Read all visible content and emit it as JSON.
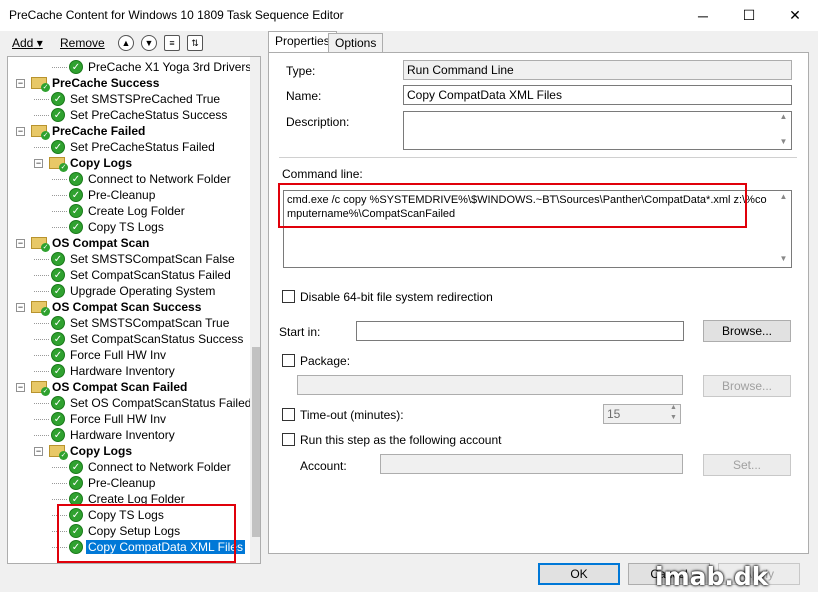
{
  "window": {
    "title": "PreCache Content for Windows 10 1809 Task Sequence Editor",
    "minimize": "─",
    "maximize": "☐",
    "close": "✕"
  },
  "toolbar": {
    "add_label": "Add",
    "remove_label": "Remove"
  },
  "tree": {
    "items": [
      {
        "label": "PreCache X1 Yoga 3rd Drivers",
        "level": 3,
        "kind": "step"
      },
      {
        "label": "PreCache Success",
        "level": 1,
        "kind": "group"
      },
      {
        "label": "Set SMSTSPreCached True",
        "level": 2,
        "kind": "step"
      },
      {
        "label": "Set PreCacheStatus Success",
        "level": 2,
        "kind": "step"
      },
      {
        "label": "PreCache Failed",
        "level": 1,
        "kind": "group"
      },
      {
        "label": "Set PreCacheStatus Failed",
        "level": 2,
        "kind": "step"
      },
      {
        "label": "Copy Logs",
        "level": 2,
        "kind": "group"
      },
      {
        "label": "Connect to Network Folder",
        "level": 3,
        "kind": "step"
      },
      {
        "label": "Pre-Cleanup",
        "level": 3,
        "kind": "step"
      },
      {
        "label": "Create Log Folder",
        "level": 3,
        "kind": "step"
      },
      {
        "label": "Copy TS Logs",
        "level": 3,
        "kind": "step"
      },
      {
        "label": "OS Compat Scan",
        "level": 1,
        "kind": "group"
      },
      {
        "label": "Set SMSTSCompatScan False",
        "level": 2,
        "kind": "step"
      },
      {
        "label": "Set CompatScanStatus Failed",
        "level": 2,
        "kind": "step"
      },
      {
        "label": "Upgrade Operating System",
        "level": 2,
        "kind": "step"
      },
      {
        "label": "OS Compat Scan Success",
        "level": 1,
        "kind": "group"
      },
      {
        "label": "Set SMSTSCompatScan True",
        "level": 2,
        "kind": "step"
      },
      {
        "label": "Set CompatScanStatus Success",
        "level": 2,
        "kind": "step"
      },
      {
        "label": "Force Full HW Inv",
        "level": 2,
        "kind": "step"
      },
      {
        "label": "Hardware Inventory",
        "level": 2,
        "kind": "step"
      },
      {
        "label": "OS Compat Scan Failed",
        "level": 1,
        "kind": "group"
      },
      {
        "label": "Set OS CompatScanStatus Failed",
        "level": 2,
        "kind": "step"
      },
      {
        "label": "Force Full HW Inv",
        "level": 2,
        "kind": "step"
      },
      {
        "label": "Hardware Inventory",
        "level": 2,
        "kind": "step"
      },
      {
        "label": "Copy Logs",
        "level": 2,
        "kind": "group"
      },
      {
        "label": "Connect to Network Folder",
        "level": 3,
        "kind": "step"
      },
      {
        "label": "Pre-Cleanup",
        "level": 3,
        "kind": "step"
      },
      {
        "label": "Create Log Folder",
        "level": 3,
        "kind": "step"
      },
      {
        "label": "Copy TS Logs",
        "level": 3,
        "kind": "step"
      },
      {
        "label": "Copy Setup Logs",
        "level": 3,
        "kind": "step"
      },
      {
        "label": "Copy CompatData XML Files",
        "level": 3,
        "kind": "step",
        "selected": true
      }
    ]
  },
  "tabs": [
    {
      "label": "Properties",
      "active": true
    },
    {
      "label": "Options",
      "active": false
    }
  ],
  "properties": {
    "type_label": "Type:",
    "type_value": "Run Command Line",
    "name_label": "Name:",
    "name_value": "Copy CompatData XML Files",
    "description_label": "Description:",
    "description_value": "",
    "command_line_label": "Command line:",
    "command_line_value": "cmd.exe /c copy %SYSTEMDRIVE%\\$WINDOWS.~BT\\Sources\\Panther\\CompatData*.xml z:\\%computername%\\CompatScanFailed",
    "disable_64bit_label": "Disable 64-bit file system redirection",
    "start_in_label": "Start in:",
    "start_in_value": "",
    "browse_label": "Browse...",
    "package_label": "Package:",
    "package_value": "",
    "browse2_label": "Browse...",
    "timeout_label": "Time-out (minutes):",
    "timeout_value": "15",
    "run_as_label": "Run this step as the following account",
    "account_label": "Account:",
    "account_value": "",
    "set_label": "Set..."
  },
  "footer": {
    "ok_label": "OK",
    "cancel_label": "Cancel",
    "apply_label": "Apply"
  },
  "watermark": "imab.dk",
  "colors": {
    "selection": "#0078d7",
    "highlight_box": "#e0000a",
    "success_check": "#2fa12f"
  }
}
